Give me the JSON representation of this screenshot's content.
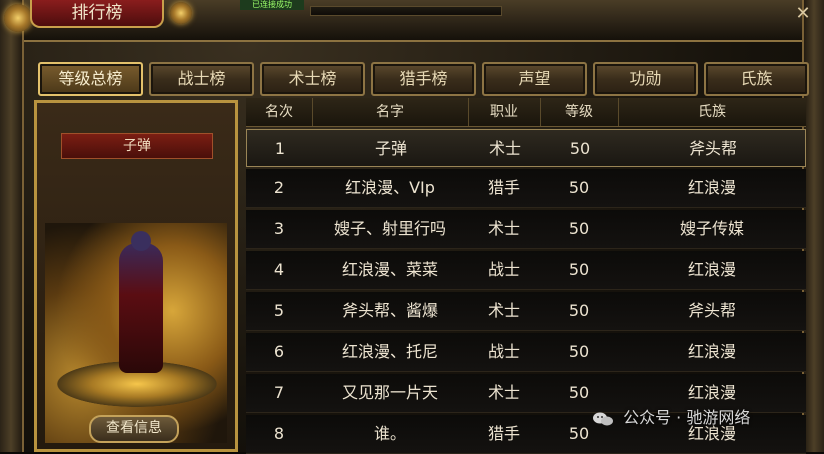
{
  "window": {
    "title": "排行榜",
    "top_badge": "已连接成功",
    "close_label": "✕"
  },
  "tabs": [
    {
      "label": "等级总榜",
      "active": true
    },
    {
      "label": "战士榜",
      "active": false
    },
    {
      "label": "术士榜",
      "active": false
    },
    {
      "label": "猎手榜",
      "active": false
    },
    {
      "label": "声望",
      "active": false
    },
    {
      "label": "功勋",
      "active": false
    },
    {
      "label": "氏族",
      "active": false
    }
  ],
  "character": {
    "name": "子弹",
    "view_button": "查看信息"
  },
  "table": {
    "headers": {
      "rank": "名次",
      "name": "名字",
      "job": "职业",
      "level": "等级",
      "clan": "氏族"
    },
    "rows": [
      {
        "rank": "1",
        "name": "子弹",
        "job": "术士",
        "level": "50",
        "clan": "斧头帮"
      },
      {
        "rank": "2",
        "name": "红浪漫、VIp",
        "job": "猎手",
        "level": "50",
        "clan": "红浪漫"
      },
      {
        "rank": "3",
        "name": "嫂子、射里行吗",
        "job": "术士",
        "level": "50",
        "clan": "嫂子传媒"
      },
      {
        "rank": "4",
        "name": "红浪漫、菜菜",
        "job": "战士",
        "level": "50",
        "clan": "红浪漫"
      },
      {
        "rank": "5",
        "name": "斧头帮、酱爆",
        "job": "术士",
        "level": "50",
        "clan": "斧头帮"
      },
      {
        "rank": "6",
        "name": "红浪漫、托尼",
        "job": "战士",
        "level": "50",
        "clan": "红浪漫"
      },
      {
        "rank": "7",
        "name": "又见那一片天",
        "job": "术士",
        "level": "50",
        "clan": "红浪漫"
      },
      {
        "rank": "8",
        "name": "谁。",
        "job": "猎手",
        "level": "50",
        "clan": "红浪漫"
      }
    ]
  },
  "watermark": {
    "text": "公众号 · 驰游网络",
    "icon": "wechat-icon"
  }
}
